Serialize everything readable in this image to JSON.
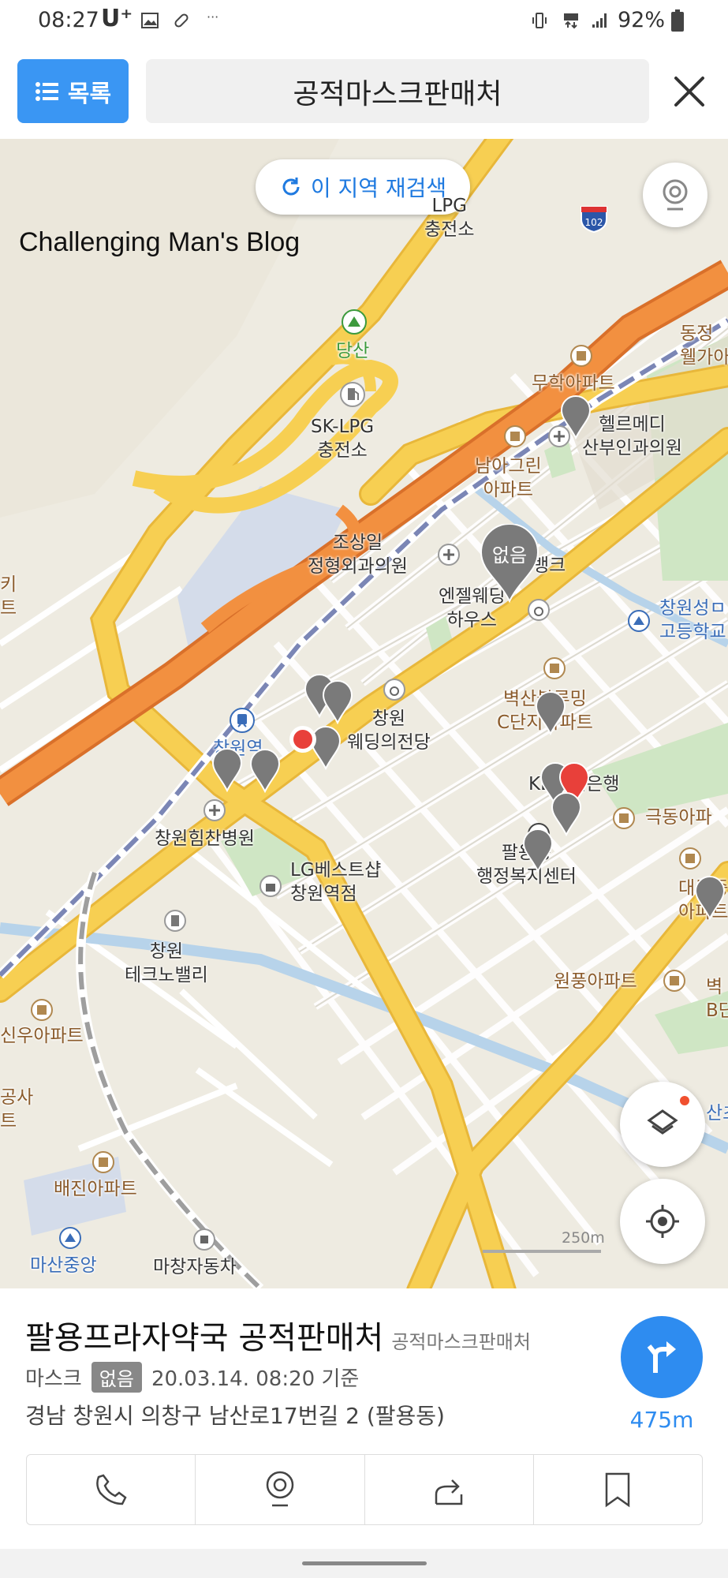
{
  "status_bar": {
    "time": "08:27",
    "carrier": "U⁺",
    "more": "···",
    "battery": "92%"
  },
  "header": {
    "list_button": "목록",
    "search_query": "공적마스크판매처",
    "close_icon": "close-icon"
  },
  "map": {
    "watermark": "Challenging Man's Blog",
    "research_button": "이 지역 재검색",
    "highway_shield": "102",
    "scale": "250m",
    "labels": {
      "lpg_top": "LPG\n충전소",
      "dangsan": "당산",
      "sk_lpg": "SK-LPG\n충전소",
      "muhak": "무학아파트",
      "dongjeong": "동정\n웰가아",
      "hello_medi": "헬르메디\n산부인과의원",
      "namagreen": "남아그린\n아파트",
      "josangil": "조상일\n정형외과의원",
      "bank": "뱅크",
      "angel_wedding": "엔젤웨딩\n하우스",
      "changwon_high": "창원성ㅁ\n고등학교",
      "changwon_wedding": "창원\n웨딩의전당",
      "changwon_station": "창원역",
      "byeoksan": "벽산블루밍\nC단지아파트",
      "kb_bank": "KB국민은행",
      "geukdong": "극동아파",
      "changwon_himchan": "창원힘찬병원",
      "lg_best": "LG베스트샵\n창원역점",
      "paryong": "팔용동\n행정복지센터",
      "daedong": "대동중\n아파트",
      "changwon_techno": "창원\n테크노밸리",
      "sinwoo": "신우아파트",
      "wonpung": "원풍아파트",
      "b_bldg": "벽\nB단",
      "sansa": "공사\n트",
      "baejin": "배진아파트",
      "masan_jungang": "마산중앙",
      "machang": "마창자동차",
      "left_edge": "키\n트",
      "san_label": "산초",
      "pin_none": "없음"
    }
  },
  "place": {
    "name": "팔용프라자약국 공적판매처",
    "category": "공적마스크판매처",
    "mask_label": "마스크",
    "mask_status": "없음",
    "updated": "20.03.14. 08:20 기준",
    "address": "경남 창원시 의창구 남산로17번길 2 (팔용동)",
    "distance": "475m"
  },
  "actions": [
    "phone-icon",
    "streetview-icon",
    "share-icon",
    "bookmark-icon"
  ],
  "colors": {
    "accent": "#2e8cf0",
    "highway": "#f08a3c",
    "main_road": "#f7c640",
    "railway": "#7b86b5",
    "pin_gray": "#7a7a7a",
    "pin_red": "#e8403a"
  }
}
